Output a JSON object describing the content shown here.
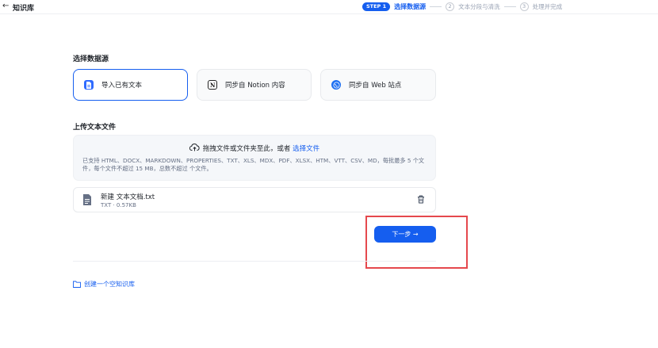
{
  "header": {
    "back_icon": "arrow-left-icon",
    "title": "知识库"
  },
  "steps": [
    {
      "badge": "STEP 1",
      "label": "选择数据源",
      "active": true
    },
    {
      "number": "2",
      "label": "文本分段与清洗",
      "active": false
    },
    {
      "number": "3",
      "label": "处理并完成",
      "active": false
    }
  ],
  "datasource": {
    "heading": "选择数据源",
    "options": [
      {
        "label": "导入已有文本",
        "icon": "file-icon",
        "selected": true
      },
      {
        "label": "同步自 Notion 内容",
        "icon": "notion-icon",
        "selected": false
      },
      {
        "label": "同步自 Web 站点",
        "icon": "globe-icon",
        "selected": false
      }
    ]
  },
  "upload": {
    "heading": "上传文本文件",
    "drag_text": "拖拽文件或文件夹至此，或者 ",
    "pick_link": "选择文件",
    "desc": "已支持 HTML、DOCX、MARKDOWN、PROPERTIES、TXT、XLS、MDX、PDF、XLSX、HTM、VTT、CSV、MD，每批最多 5 个文件，每个文件不超过 15 MB，总数不超过 个文件。"
  },
  "file": {
    "name": "新建 文本文档.txt",
    "meta": "TXT · 0.57KB"
  },
  "actions": {
    "next_label": "下一步 →",
    "create_empty": "创建一个空知识库"
  },
  "colors": {
    "accent": "#155eef",
    "highlight": "#e5484d"
  }
}
